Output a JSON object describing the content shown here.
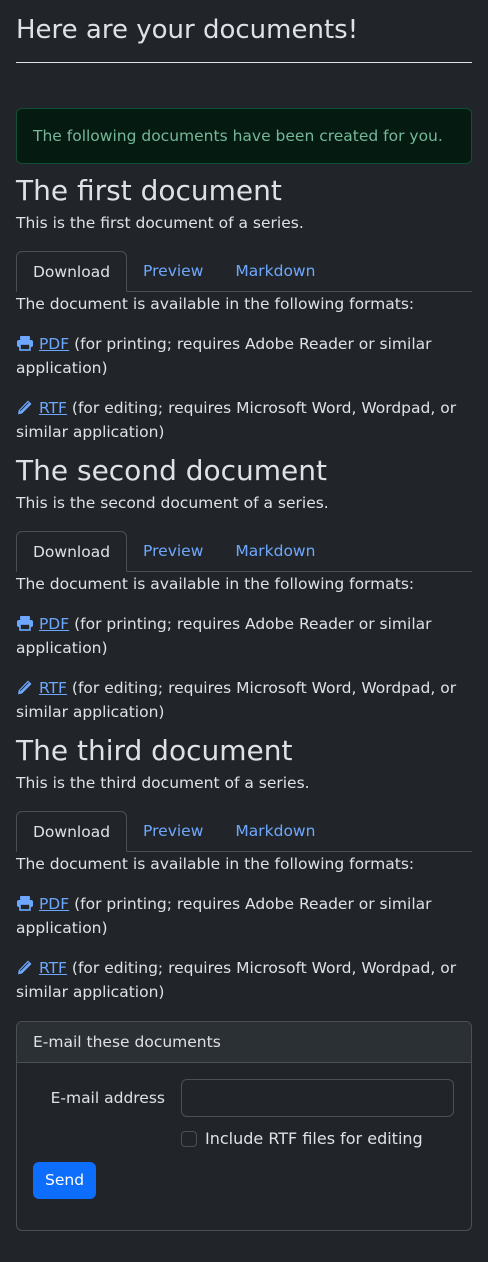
{
  "page_title": "Here are your documents!",
  "alert_text": "The following documents have been created for you.",
  "tabs": [
    "Download",
    "Preview",
    "Markdown"
  ],
  "documents": [
    {
      "title": "The first document",
      "description": "This is the first document of a series.",
      "formats_intro": "The document is available in the following formats:",
      "formats": [
        {
          "icon": "printer-icon",
          "label": "PDF",
          "note": "(for printing; requires Adobe Reader or similar application)"
        },
        {
          "icon": "pencil-icon",
          "label": "RTF",
          "note": "(for editing; requires Microsoft Word, Wordpad, or similar application)"
        }
      ]
    },
    {
      "title": "The second document",
      "description": "This is the second document of a series.",
      "formats_intro": "The document is available in the following formats:",
      "formats": [
        {
          "icon": "printer-icon",
          "label": "PDF",
          "note": "(for printing; requires Adobe Reader or similar application)"
        },
        {
          "icon": "pencil-icon",
          "label": "RTF",
          "note": "(for editing; requires Microsoft Word, Wordpad, or similar application)"
        }
      ]
    },
    {
      "title": "The third document",
      "description": "This is the third document of a series.",
      "formats_intro": "The document is available in the following formats:",
      "formats": [
        {
          "icon": "printer-icon",
          "label": "PDF",
          "note": "(for printing; requires Adobe Reader or similar application)"
        },
        {
          "icon": "pencil-icon",
          "label": "RTF",
          "note": "(for editing; requires Microsoft Word, Wordpad, or similar application)"
        }
      ]
    }
  ],
  "email_card": {
    "header": "E-mail these documents",
    "email_label": "E-mail address",
    "email_value": "",
    "checkbox_label": "Include RTF files for editing",
    "send_label": "Send"
  },
  "colors": {
    "background": "#212529",
    "link": "#6ea8fe",
    "alert_text": "#75b798",
    "button": "#0d6efd"
  }
}
